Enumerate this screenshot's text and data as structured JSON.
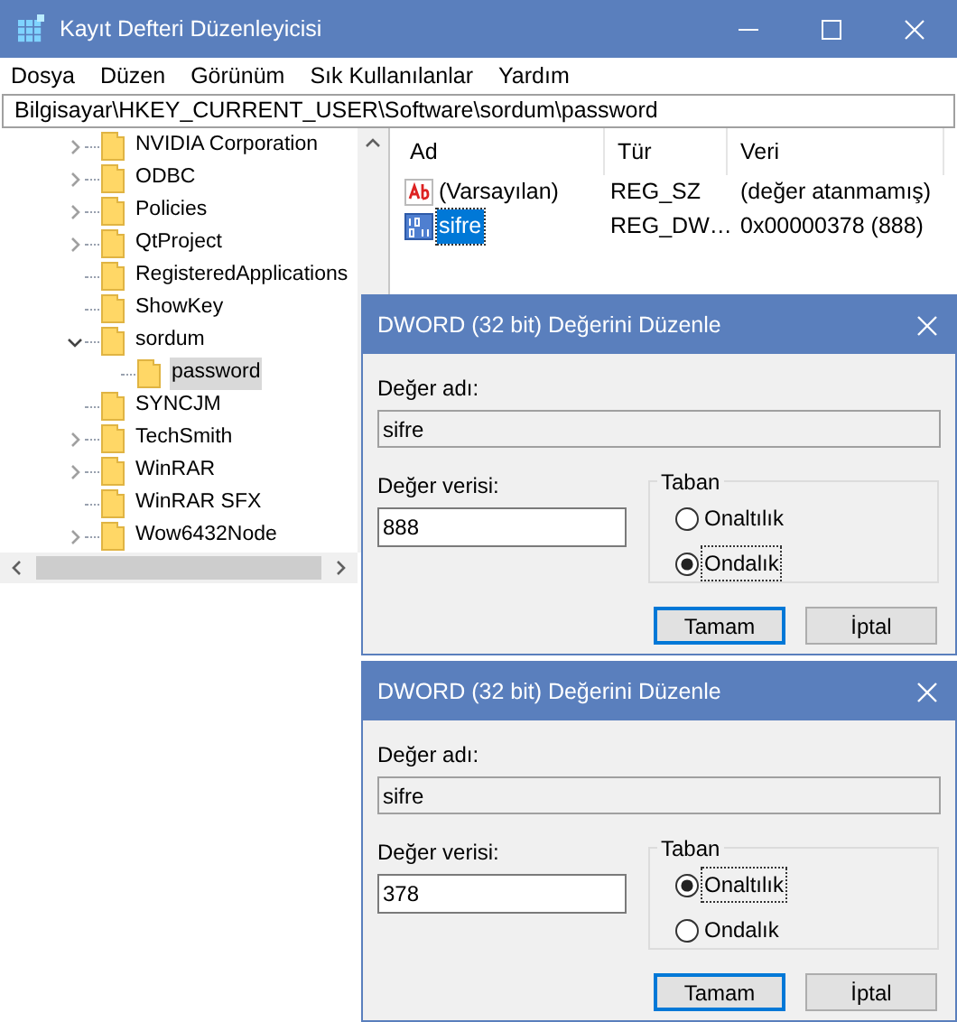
{
  "window": {
    "title": "Kayıt Defteri Düzenleyicisi"
  },
  "menu": [
    "Dosya",
    "Düzen",
    "Görünüm",
    "Sık Kullanılanlar",
    "Yardım"
  ],
  "address": "Bilgisayar\\HKEY_CURRENT_USER\\Software\\sordum\\password",
  "tree": [
    {
      "label": "NVIDIA Corporation",
      "has_children": true,
      "expanded": false,
      "selected": false
    },
    {
      "label": "ODBC",
      "has_children": true,
      "expanded": false,
      "selected": false
    },
    {
      "label": "Policies",
      "has_children": true,
      "expanded": false,
      "selected": false
    },
    {
      "label": "QtProject",
      "has_children": true,
      "expanded": false,
      "selected": false
    },
    {
      "label": "RegisteredApplications",
      "has_children": false,
      "selected": false
    },
    {
      "label": "ShowKey",
      "has_children": false,
      "selected": false
    },
    {
      "label": "sordum",
      "has_children": true,
      "expanded": true,
      "selected": false,
      "children": [
        {
          "label": "password",
          "has_children": false,
          "selected": true
        }
      ]
    },
    {
      "label": "SYNCJM",
      "has_children": false,
      "selected": false
    },
    {
      "label": "TechSmith",
      "has_children": true,
      "expanded": false,
      "selected": false
    },
    {
      "label": "WinRAR",
      "has_children": true,
      "expanded": false,
      "selected": false
    },
    {
      "label": "WinRAR SFX",
      "has_children": false,
      "selected": false
    },
    {
      "label": "Wow6432Node",
      "has_children": true,
      "expanded": false,
      "selected": false
    }
  ],
  "values": {
    "columns": [
      "Ad",
      "Tür",
      "Veri"
    ],
    "rows": [
      {
        "kind": "string",
        "name": "(Varsayılan)",
        "type": "REG_SZ",
        "data": "(değer atanmamış)",
        "selected": false
      },
      {
        "kind": "binary",
        "name": "sifre",
        "type": "REG_DW…",
        "data": "0x00000378 (888)",
        "selected": true
      }
    ]
  },
  "dialogs": [
    {
      "title": "DWORD (32 bit) Değerini Düzenle",
      "name_label": "Değer adı:",
      "name_value": "sifre",
      "data_label": "Değer verisi:",
      "data_value": "888",
      "base_label": "Taban",
      "bases": [
        {
          "label": "Onaltılık",
          "selected": false
        },
        {
          "label": "Ondalık",
          "selected": true
        }
      ],
      "buttons": [
        {
          "label": "Tamam",
          "default": true
        },
        {
          "label": "İptal",
          "default": false
        }
      ]
    },
    {
      "title": "DWORD (32 bit) Değerini Düzenle",
      "name_label": "Değer adı:",
      "name_value": "sifre",
      "data_label": "Değer verisi:",
      "data_value": "378",
      "base_label": "Taban",
      "bases": [
        {
          "label": "Onaltılık",
          "selected": true
        },
        {
          "label": "Ondalık",
          "selected": false
        }
      ],
      "buttons": [
        {
          "label": "Tamam",
          "default": true
        },
        {
          "label": "İptal",
          "default": false
        }
      ]
    }
  ]
}
